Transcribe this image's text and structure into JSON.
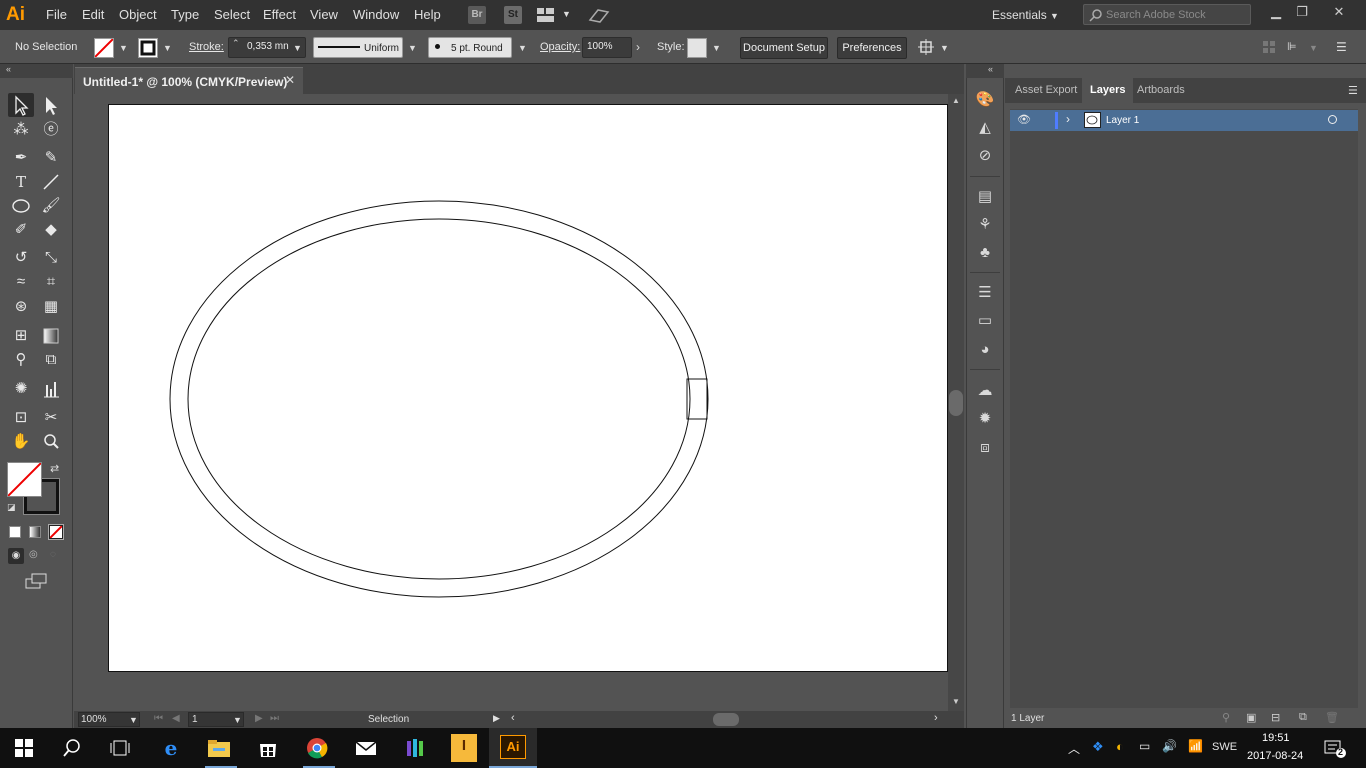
{
  "app": {
    "logo": "Ai",
    "menu": [
      "File",
      "Edit",
      "Object",
      "Type",
      "Select",
      "Effect",
      "View",
      "Window",
      "Help"
    ],
    "bridge_label": "Br",
    "stock_label": "St",
    "workspace": "Essentials",
    "search_placeholder": "Search Adobe Stock"
  },
  "control_bar": {
    "selection_state": "No Selection",
    "stroke_label": "Stroke:",
    "stroke_weight": "0,353 mn",
    "profile": "Uniform",
    "brush": "5 pt. Round",
    "opacity_label": "Opacity:",
    "opacity_value": "100%",
    "style_label": "Style:",
    "document_setup": "Document Setup",
    "preferences": "Preferences"
  },
  "document": {
    "tab_title": "Untitled-1* @ 100% (CMYK/Preview)",
    "close_glyph": "✕"
  },
  "status_bar": {
    "zoom": "100%",
    "artboard_number": "1",
    "current_tool": "Selection"
  },
  "layers_panel": {
    "tabs": [
      "Asset Export",
      "Layers",
      "Artboards"
    ],
    "active_tab": "Layers",
    "layers": [
      {
        "name": "Layer 1",
        "visible": true
      }
    ],
    "count": "1 Layer"
  },
  "taskbar": {
    "language": "SWE",
    "time": "19:51",
    "date": "2017-08-24",
    "notifications": "2",
    "active_app": "Ai"
  },
  "colors": {
    "ai_orange": "#ff9a00",
    "layer_highlight": "#4b6e95",
    "panel_bg": "#535353",
    "menubar_bg": "#323232"
  }
}
